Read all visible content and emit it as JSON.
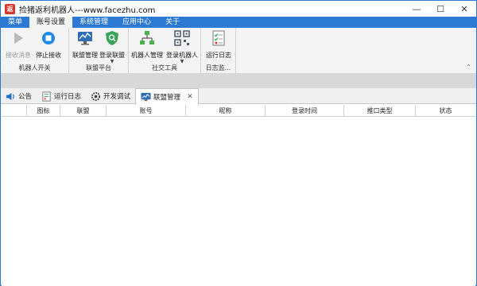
{
  "window": {
    "title": "捡猪返利机器人---www.facezhu.com",
    "app_icon_text": "返",
    "controls": [
      "—",
      "☐",
      "✕"
    ]
  },
  "menubar": {
    "items": [
      "菜单",
      "账号设置",
      "系统管理",
      "应用中心",
      "关于"
    ],
    "active_index": 1
  },
  "ribbon": {
    "groups": [
      {
        "label": "机器人开关",
        "buttons": [
          {
            "label": "接收消息",
            "icon": "play-icon",
            "enabled": false
          },
          {
            "label": "停止接收",
            "icon": "stop-icon",
            "enabled": true
          }
        ]
      },
      {
        "label": "联盟平台",
        "buttons": [
          {
            "label": "联盟管理",
            "icon": "chart-monitor-icon",
            "enabled": true
          },
          {
            "label": "登录联盟",
            "icon": "shield-search-icon",
            "enabled": true,
            "dropdown": true
          }
        ]
      },
      {
        "label": "社交工具",
        "buttons": [
          {
            "label": "机器人管理",
            "icon": "network-icon",
            "enabled": true
          },
          {
            "label": "登录机器人",
            "icon": "qrcode-icon",
            "enabled": true,
            "dropdown": true
          }
        ]
      },
      {
        "label": "日志监...",
        "buttons": [
          {
            "label": "运行日志",
            "icon": "checklist-icon",
            "enabled": true
          }
        ]
      }
    ],
    "collapse_glyph": "⌃"
  },
  "tabs": [
    {
      "label": "公告",
      "icon": "speaker-icon"
    },
    {
      "label": "运行日志",
      "icon": "checklist-icon"
    },
    {
      "label": "开发调试",
      "icon": "gear-icon"
    },
    {
      "label": "联盟管理",
      "icon": "chart-monitor-icon",
      "active": true,
      "close": "✕"
    }
  ],
  "table": {
    "columns": [
      "图标",
      "联盟",
      "账号",
      "昵称",
      "登录时间",
      "推口类型",
      "状态"
    ],
    "rows": []
  },
  "colors": {
    "accent": "#2b79d3",
    "ribbon_bg": "#f3f3f3"
  }
}
